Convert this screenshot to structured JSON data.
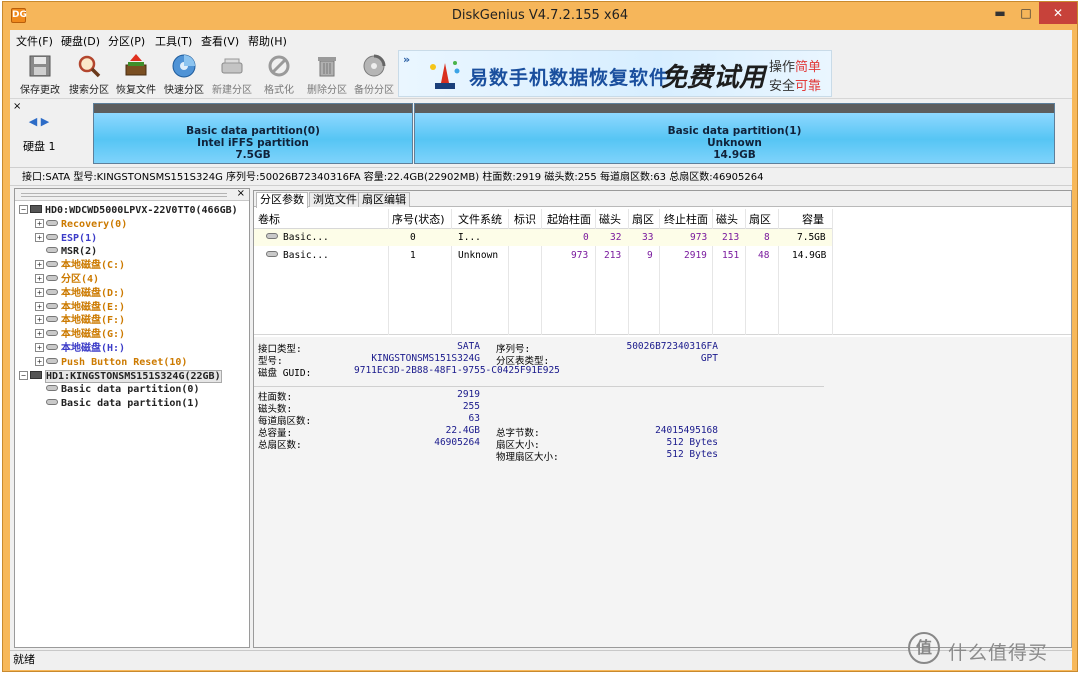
{
  "window": {
    "title": "DiskGenius V4.7.2.155 x64",
    "app_icon": "DG",
    "controls": {
      "minimize": "▬",
      "maximize": "□",
      "close": "✕"
    }
  },
  "menu": [
    "文件(F)",
    "硬盘(D)",
    "分区(P)",
    "工具(T)",
    "查看(V)",
    "帮助(H)"
  ],
  "toolbar": [
    {
      "label": "保存更改",
      "icon": "save-icon",
      "enabled": true
    },
    {
      "label": "搜索分区",
      "icon": "search-icon",
      "enabled": true
    },
    {
      "label": "恢复文件",
      "icon": "recover-icon",
      "enabled": true
    },
    {
      "label": "快速分区",
      "icon": "quick-partition-icon",
      "enabled": true
    },
    {
      "label": "新建分区",
      "icon": "new-partition-icon",
      "enabled": false
    },
    {
      "label": "格式化",
      "icon": "format-icon",
      "enabled": false
    },
    {
      "label": "删除分区",
      "icon": "trash-icon",
      "enabled": false
    },
    {
      "label": "备份分区",
      "icon": "backup-icon",
      "enabled": false
    }
  ],
  "banner": {
    "text": "易数手机数据恢复软件",
    "free": "免费试用",
    "r1_a": "操作",
    "r1_b": "简单",
    "r2_a": "安全",
    "r2_b": "可靠"
  },
  "diskmap": {
    "close": "×",
    "disk_label": "硬盘 1",
    "partitions": [
      {
        "name": "Basic data partition(0)",
        "fs": "Intel iFFS partition",
        "size": "7.5GB"
      },
      {
        "name": "Basic data partition(1)",
        "fs": "Unknown",
        "size": "14.9GB"
      }
    ]
  },
  "info_line": "接口:SATA  型号:KINGSTONSMS151S324G  序列号:50026B72340316FA  容量:22.4GB(22902MB)  柱面数:2919  磁头数:255  每道扇区数:63  总扇区数:46905264",
  "tree": {
    "close": "×",
    "nodes": [
      {
        "text": "HD0:WDCWD5000LPVX-22V0TT0(466GB)",
        "level": 0,
        "type": "disk",
        "color": "black",
        "expander": "−"
      },
      {
        "text": "Recovery(0)",
        "level": 1,
        "type": "part",
        "color": "orange",
        "expander": "+"
      },
      {
        "text": "ESP(1)",
        "level": 1,
        "type": "part",
        "color": "blue",
        "expander": "+"
      },
      {
        "text": "MSR(2)",
        "level": 1,
        "type": "part",
        "color": "black",
        "expander": ""
      },
      {
        "text": "本地磁盘(C:)",
        "level": 1,
        "type": "part",
        "color": "orange",
        "expander": "+"
      },
      {
        "text": "分区(4)",
        "level": 1,
        "type": "part",
        "color": "orange",
        "expander": "+"
      },
      {
        "text": "本地磁盘(D:)",
        "level": 1,
        "type": "part",
        "color": "orange",
        "expander": "+"
      },
      {
        "text": "本地磁盘(E:)",
        "level": 1,
        "type": "part",
        "color": "orange",
        "expander": "+"
      },
      {
        "text": "本地磁盘(F:)",
        "level": 1,
        "type": "part",
        "color": "orange",
        "expander": "+"
      },
      {
        "text": "本地磁盘(G:)",
        "level": 1,
        "type": "part",
        "color": "orange",
        "expander": "+"
      },
      {
        "text": "本地磁盘(H:)",
        "level": 1,
        "type": "part",
        "color": "blue",
        "expander": "+"
      },
      {
        "text": "Push Button Reset(10)",
        "level": 1,
        "type": "part",
        "color": "orange",
        "expander": "+"
      },
      {
        "text": "HD1:KINGSTONSMS151S324G(22GB)",
        "level": 0,
        "type": "disk",
        "color": "black",
        "expander": "−",
        "selected": true
      },
      {
        "text": "Basic data partition(0)",
        "level": 1,
        "type": "part",
        "color": "black",
        "expander": ""
      },
      {
        "text": "Basic data partition(1)",
        "level": 1,
        "type": "part",
        "color": "black",
        "expander": ""
      }
    ]
  },
  "tabs": [
    "分区参数",
    "浏览文件",
    "扇区编辑"
  ],
  "table": {
    "headers": [
      "卷标",
      "序号(状态)",
      "文件系统",
      "标识",
      "起始柱面",
      "磁头",
      "扇区",
      "终止柱面",
      "磁头",
      "扇区",
      "容量"
    ],
    "rows": [
      [
        "Basic...",
        "0",
        "I...",
        "",
        "0",
        "32",
        "33",
        "973",
        "213",
        "8",
        "7.5GB"
      ],
      [
        "Basic...",
        "1",
        "Unknown",
        "",
        "973",
        "213",
        "9",
        "2919",
        "151",
        "48",
        "14.9GB"
      ]
    ]
  },
  "details": {
    "iface_label": "接口类型:",
    "iface": "SATA",
    "serial_label": "序列号:",
    "serial": "50026B72340316FA",
    "model_label": "型号:",
    "model": "KINGSTONSMS151S324G",
    "pt_label": "分区表类型:",
    "pt": "GPT",
    "guid_label": "磁盘 GUID:",
    "guid": "9711EC3D-2B88-48F1-9755-C0425F91E925",
    "cyl_label": "柱面数:",
    "cyl": "2919",
    "heads_label": "磁头数:",
    "heads": "255",
    "spt_label": "每道扇区数:",
    "spt": "63",
    "cap_label": "总容量:",
    "cap": "22.4GB",
    "bytes_label": "总字节数:",
    "bytes": "24015495168",
    "sectors_label": "总扇区数:",
    "sectors": "46905264",
    "ss_label": "扇区大小:",
    "ss": "512 Bytes",
    "pss_label": "物理扇区大小:",
    "pss": "512 Bytes"
  },
  "status": "就绪",
  "watermark": {
    "logo": "值",
    "text": "什么值得买"
  },
  "colors": {
    "titlebar": "#f6b65a",
    "close": "#c7423a",
    "partition": "#56c5f4",
    "tree_orange": "#cc7a00",
    "tree_blue": "#3c3cc8"
  }
}
